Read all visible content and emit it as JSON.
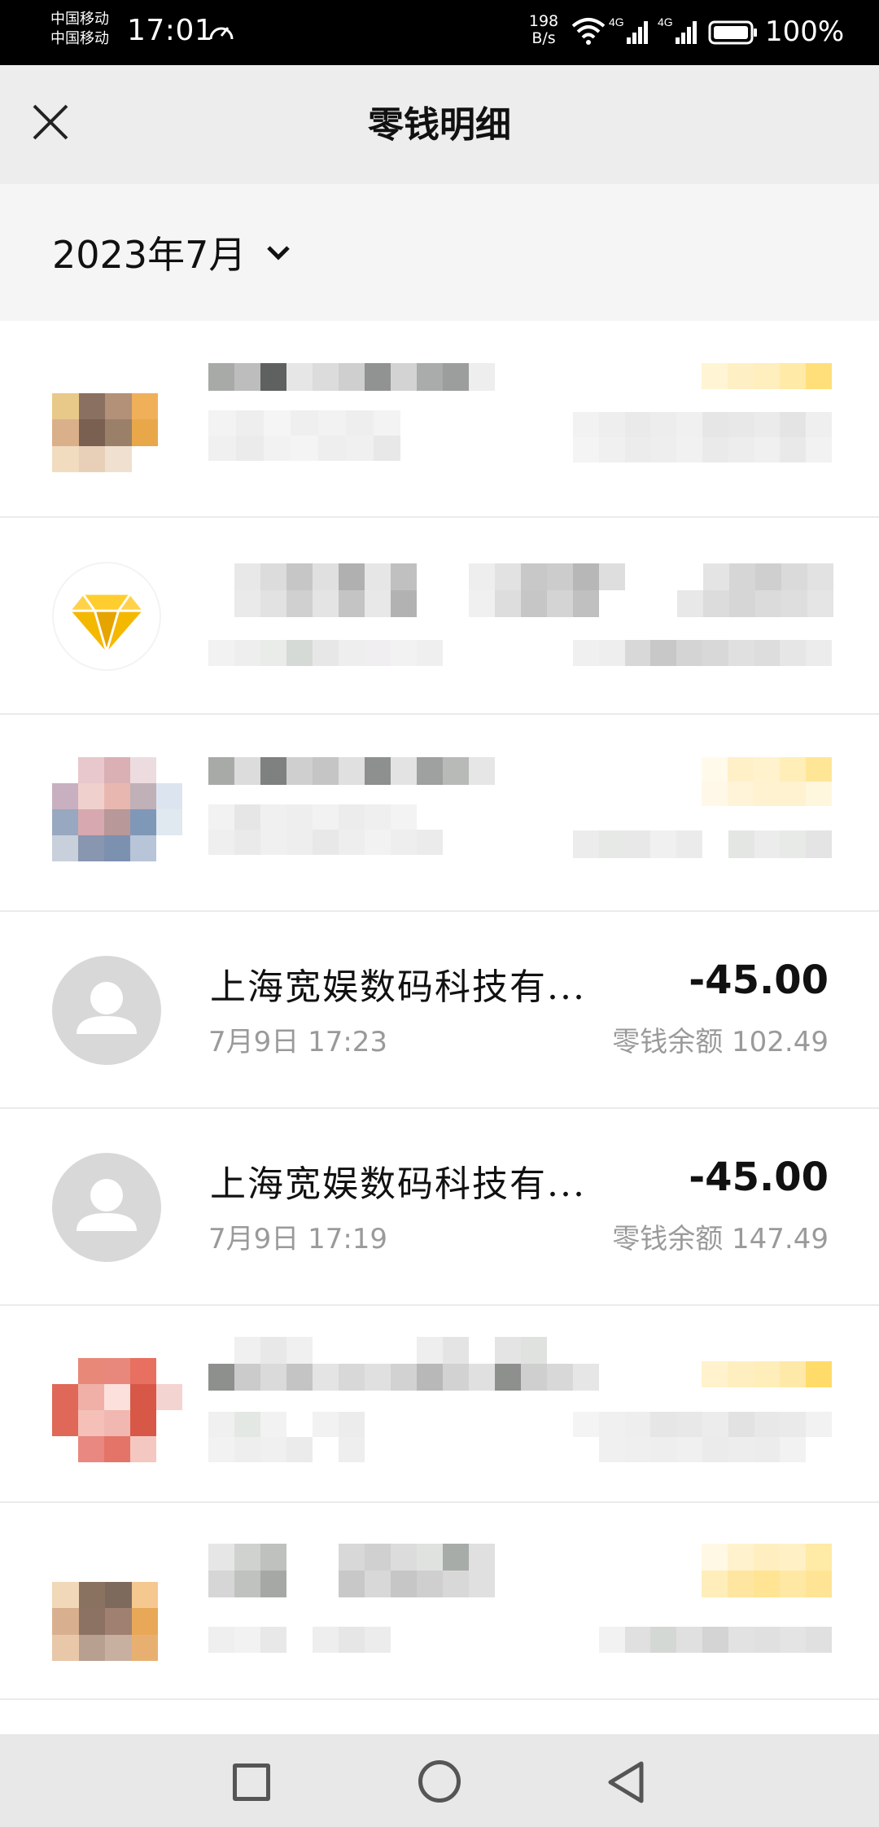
{
  "status_bar": {
    "carrier_1": "中国移动",
    "carrier_2": "中国移动",
    "time": "17:01",
    "net_speed_value": "198",
    "net_speed_unit": "B/s",
    "signal_1_label": "4G",
    "signal_2_label": "4G",
    "battery": "100%"
  },
  "header": {
    "title": "零钱明细",
    "close_icon": "close-icon"
  },
  "filter": {
    "month": "2023年7月",
    "icon": "chevron-down-icon"
  },
  "transactions": [
    {
      "id": "t4",
      "title": "上海宽娱数码科技有...",
      "amount": "-45.00",
      "time": "7月9日 17:23",
      "balance": "零钱余额 102.49"
    },
    {
      "id": "t5",
      "title": "上海宽娱数码科技有...",
      "amount": "-45.00",
      "time": "7月9日 17:19",
      "balance": "零钱余额 147.49"
    }
  ],
  "colors": {
    "header_bg": "#ededed",
    "filter_bg": "#f5f5f5",
    "amount_text": "#111111",
    "secondary_text": "#9a9a9a",
    "diamond_icon": "#f5b800"
  },
  "nav": {
    "recent_icon": "square-icon",
    "home_icon": "circle-icon",
    "back_icon": "triangle-back-icon"
  }
}
